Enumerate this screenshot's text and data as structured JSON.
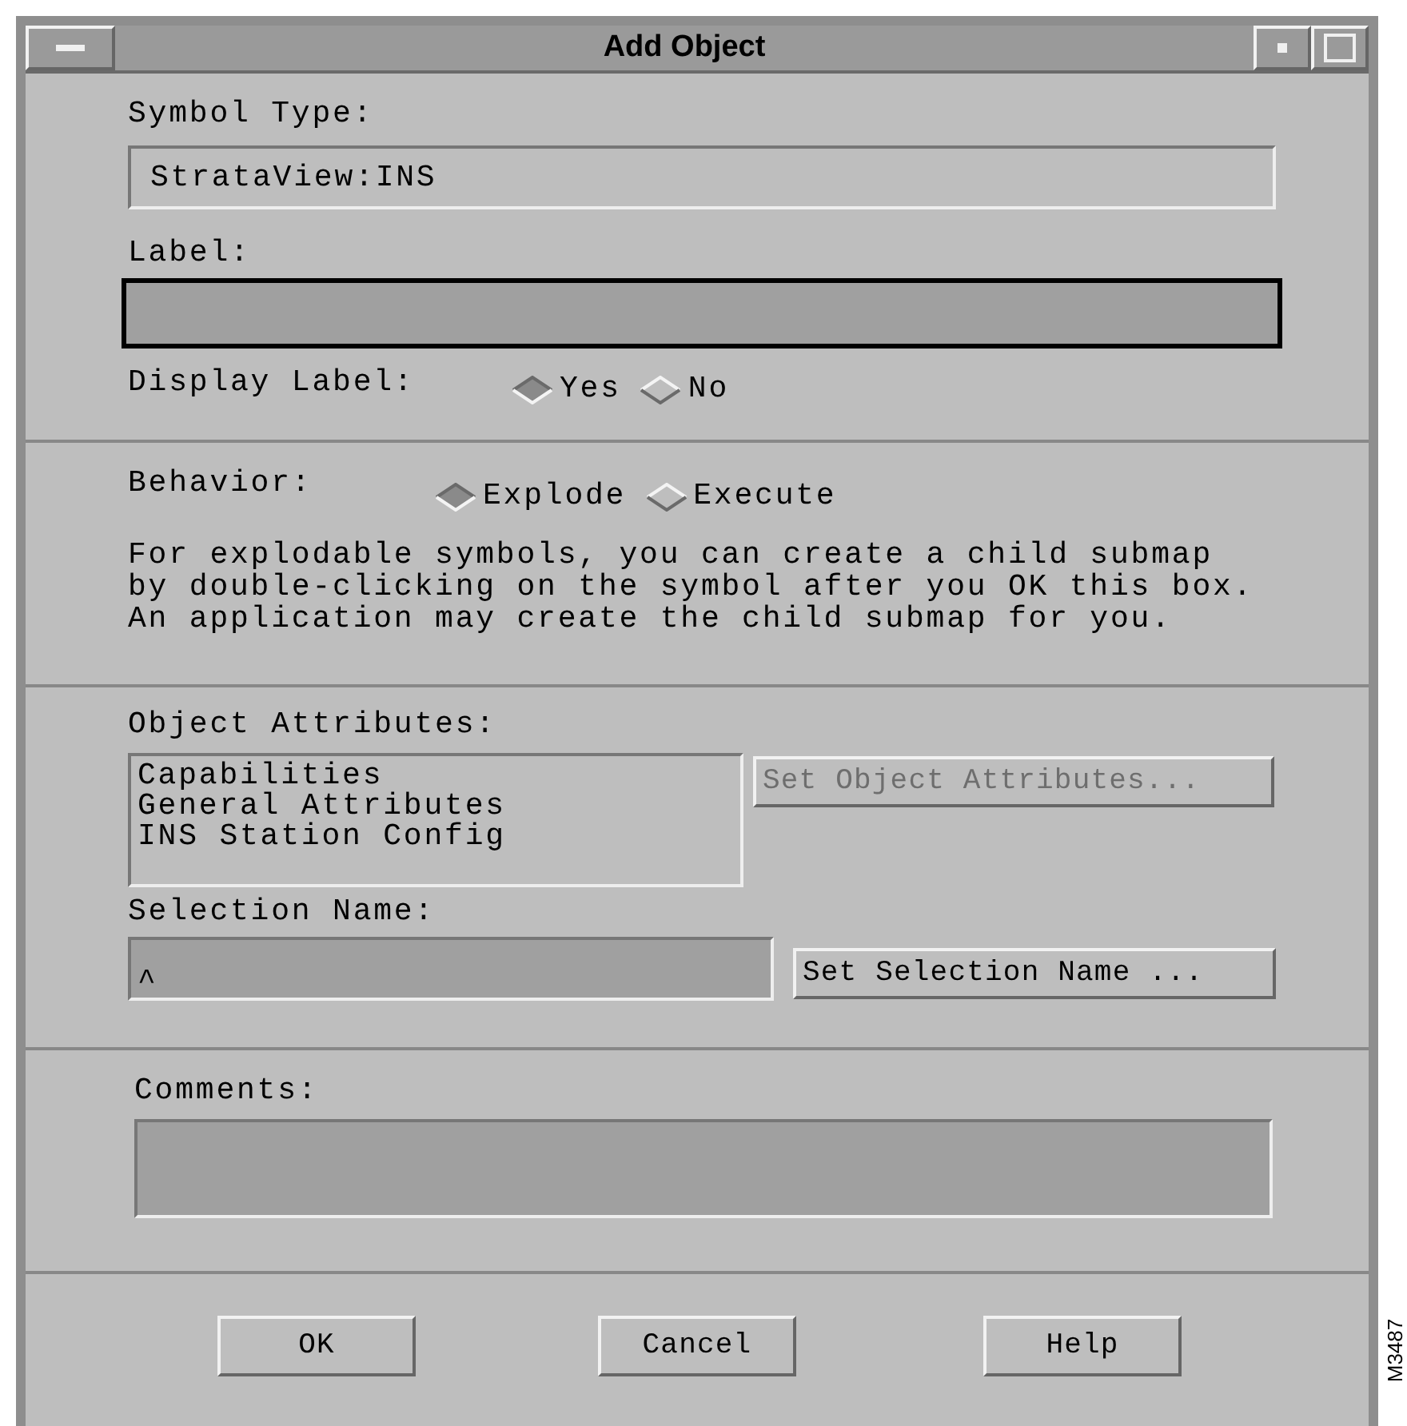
{
  "window": {
    "title": "Add Object"
  },
  "symbol_type": {
    "label": "Symbol Type:",
    "value": "StrataView:INS"
  },
  "label_field": {
    "label": "Label:",
    "focused": true
  },
  "display_label": {
    "label": "Display Label:",
    "options": [
      {
        "label": "Yes",
        "selected": true
      },
      {
        "label": "No",
        "selected": false
      }
    ]
  },
  "behavior": {
    "label": "Behavior:",
    "options": [
      {
        "label": "Explode",
        "selected": true
      },
      {
        "label": "Execute",
        "selected": false
      }
    ],
    "help_lines": [
      "For explodable symbols, you can create a child submap",
      "by double-clicking on the symbol after you OK this box.",
      "An application may create the child submap for you."
    ]
  },
  "object_attributes": {
    "label": "Object Attributes:",
    "items": [
      "Capabilities",
      "General Attributes",
      "INS Station Config"
    ],
    "button": {
      "label": "Set Object Attributes...",
      "disabled": true
    }
  },
  "selection_name": {
    "label": "Selection Name:",
    "cursor": "^",
    "button": {
      "label": "Set Selection Name ..."
    }
  },
  "comments": {
    "label": "Comments:"
  },
  "buttons": [
    "OK",
    "Cancel",
    "Help"
  ],
  "figure_id": "M3487"
}
